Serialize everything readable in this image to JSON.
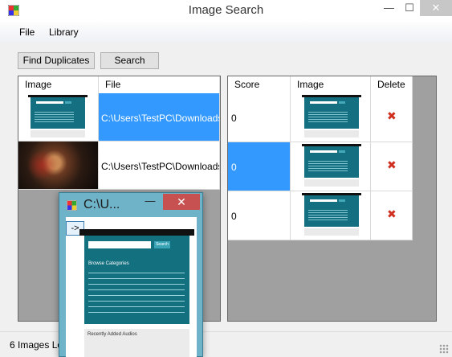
{
  "window": {
    "title": "Image Search"
  },
  "menu": {
    "file": "File",
    "library": "Library"
  },
  "toolbar": {
    "find_duplicates": "Find Duplicates",
    "search": "Search"
  },
  "library_grid": {
    "columns": [
      "Image",
      "File"
    ],
    "rows": [
      {
        "image": "website-screenshot-thumbnail",
        "file": "C:\\Users\\TestPC\\Downloads\\",
        "selected": true
      },
      {
        "image": "game-art-thumbnail",
        "file": "C:\\Users\\TestPC\\Downloads\\",
        "selected": false
      }
    ]
  },
  "results_grid": {
    "columns": [
      "Score",
      "Image",
      "Delete"
    ],
    "rows": [
      {
        "score": "0",
        "image": "website-screenshot-thumbnail",
        "selected": false
      },
      {
        "score": "0",
        "image": "website-screenshot-thumbnail",
        "selected": true
      },
      {
        "score": "0",
        "image": "website-screenshot-thumbnail",
        "selected": false
      }
    ]
  },
  "status": {
    "text": "6 Images Lo"
  },
  "preview": {
    "title": "C:\\U...",
    "arrow_label": "->",
    "page_category": "Browse Categories",
    "page_recent": "Recently Added Audios",
    "page_search_btn": "Search"
  },
  "colors": {
    "selection": "#3399ff",
    "grid_bg": "#a0a0a0",
    "popup_frame": "#6fb3c9",
    "close_red": "#c75050"
  }
}
